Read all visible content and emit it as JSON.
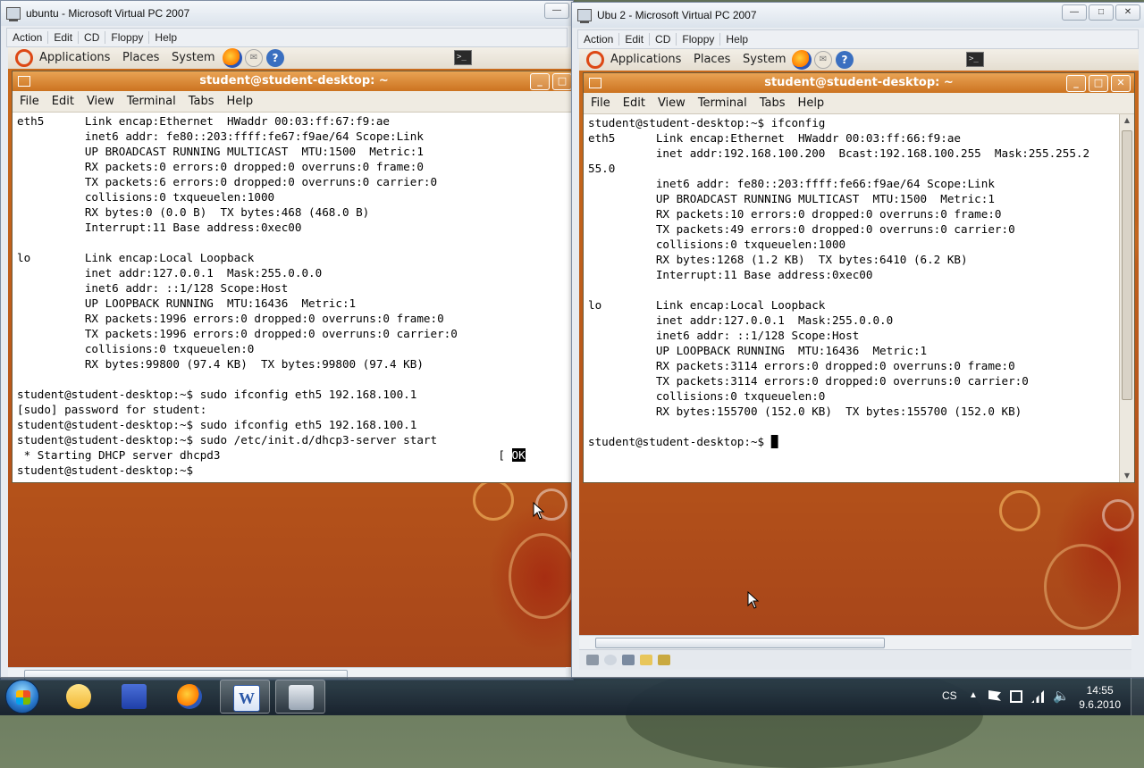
{
  "left_vm": {
    "window_title": "ubuntu - Microsoft Virtual PC 2007",
    "menu": [
      "Action",
      "Edit",
      "CD",
      "Floppy",
      "Help"
    ],
    "panel": {
      "applications": "Applications",
      "places": "Places",
      "system": "System"
    },
    "terminal": {
      "title": "student@student-desktop: ~",
      "menu": [
        "File",
        "Edit",
        "View",
        "Terminal",
        "Tabs",
        "Help"
      ],
      "lines": [
        "eth5      Link encap:Ethernet  HWaddr 00:03:ff:67:f9:ae",
        "          inet6 addr: fe80::203:ffff:fe67:f9ae/64 Scope:Link",
        "          UP BROADCAST RUNNING MULTICAST  MTU:1500  Metric:1",
        "          RX packets:0 errors:0 dropped:0 overruns:0 frame:0",
        "          TX packets:6 errors:0 dropped:0 overruns:0 carrier:0",
        "          collisions:0 txqueuelen:1000",
        "          RX bytes:0 (0.0 B)  TX bytes:468 (468.0 B)",
        "          Interrupt:11 Base address:0xec00",
        "",
        "lo        Link encap:Local Loopback",
        "          inet addr:127.0.0.1  Mask:255.0.0.0",
        "          inet6 addr: ::1/128 Scope:Host",
        "          UP LOOPBACK RUNNING  MTU:16436  Metric:1",
        "          RX packets:1996 errors:0 dropped:0 overruns:0 frame:0",
        "          TX packets:1996 errors:0 dropped:0 overruns:0 carrier:0",
        "          collisions:0 txqueuelen:0",
        "          RX bytes:99800 (97.4 KB)  TX bytes:99800 (97.4 KB)",
        "",
        "student@student-desktop:~$ sudo ifconfig eth5 192.168.100.1",
        "[sudo] password for student:",
        "student@student-desktop:~$ sudo ifconfig eth5 192.168.100.1",
        "student@student-desktop:~$ sudo /etc/init.d/dhcp3-server start"
      ],
      "dhcp_line": " * Starting DHCP server dhcpd3                                         [ ",
      "ok_label": "OK",
      "last_prompt": "student@student-desktop:~$ "
    }
  },
  "right_vm": {
    "window_title": "Ubu 2 - Microsoft Virtual PC 2007",
    "menu": [
      "Action",
      "Edit",
      "CD",
      "Floppy",
      "Help"
    ],
    "panel": {
      "applications": "Applications",
      "places": "Places",
      "system": "System"
    },
    "terminal": {
      "title": "student@student-desktop: ~",
      "menu": [
        "File",
        "Edit",
        "View",
        "Terminal",
        "Tabs",
        "Help"
      ],
      "lines": [
        "student@student-desktop:~$ ifconfig",
        "eth5      Link encap:Ethernet  HWaddr 00:03:ff:66:f9:ae",
        "          inet addr:192.168.100.200  Bcast:192.168.100.255  Mask:255.255.2",
        "55.0",
        "          inet6 addr: fe80::203:ffff:fe66:f9ae/64 Scope:Link",
        "          UP BROADCAST RUNNING MULTICAST  MTU:1500  Metric:1",
        "          RX packets:10 errors:0 dropped:0 overruns:0 frame:0",
        "          TX packets:49 errors:0 dropped:0 overruns:0 carrier:0",
        "          collisions:0 txqueuelen:1000",
        "          RX bytes:1268 (1.2 KB)  TX bytes:6410 (6.2 KB)",
        "          Interrupt:11 Base address:0xec00",
        "",
        "lo        Link encap:Local Loopback",
        "          inet addr:127.0.0.1  Mask:255.0.0.0",
        "          inet6 addr: ::1/128 Scope:Host",
        "          UP LOOPBACK RUNNING  MTU:16436  Metric:1",
        "          RX packets:3114 errors:0 dropped:0 overruns:0 frame:0",
        "          TX packets:3114 errors:0 dropped:0 overruns:0 carrier:0",
        "          collisions:0 txqueuelen:0",
        "          RX bytes:155700 (152.0 KB)  TX bytes:155700 (152.0 KB)",
        ""
      ],
      "last_prompt": "student@student-desktop:~$ "
    }
  },
  "taskbar": {
    "apps": [
      "outlook-icon",
      "save-disk-icon",
      "firefox-icon",
      "word-icon",
      "virtual-pc-icon"
    ],
    "language": "CS",
    "time": "14:55",
    "date": "9.6.2010"
  },
  "colors": {
    "ubuntu_orange": "#dd4814",
    "terminal_title": "#cc7320",
    "desktop": "#b8561a"
  }
}
